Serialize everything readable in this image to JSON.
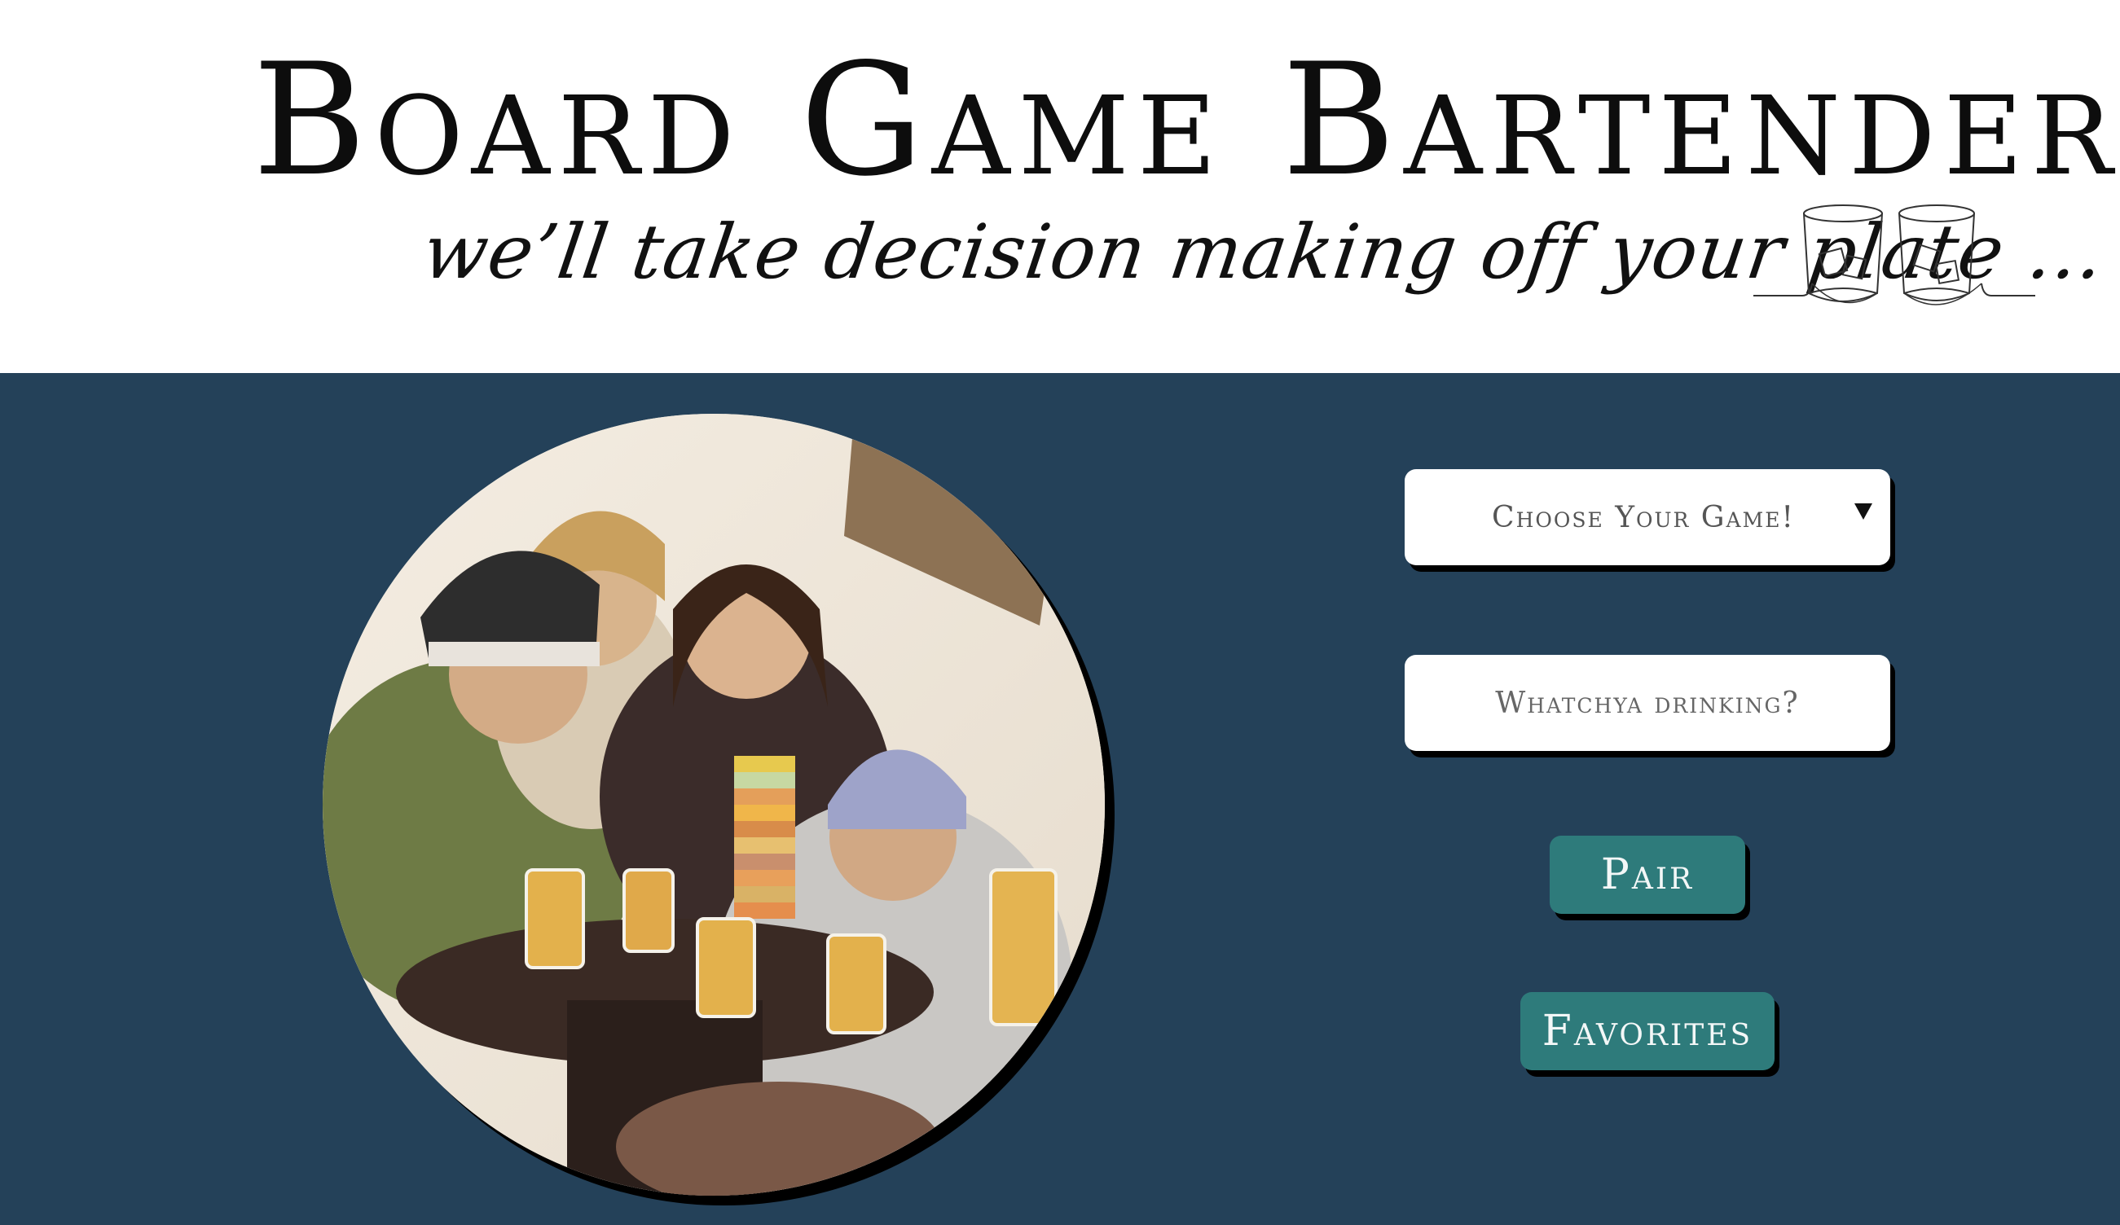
{
  "header": {
    "title": "Board Game Bartender",
    "tagline": "we’ll take decision making off your plate …"
  },
  "icons": {
    "logo": "whiskey-glasses-icon",
    "dropdown": "chevron-down-icon"
  },
  "form": {
    "game_select": {
      "selected": "Choose Your Game!"
    },
    "drink_input": {
      "value": "",
      "placeholder": "Whatchya drinking?"
    },
    "pair_label": "Pair",
    "favorites_label": "Favorites"
  },
  "colors": {
    "background_panel": "#244159",
    "button": "#2e7b7b",
    "header_bg": "#ffffff"
  }
}
